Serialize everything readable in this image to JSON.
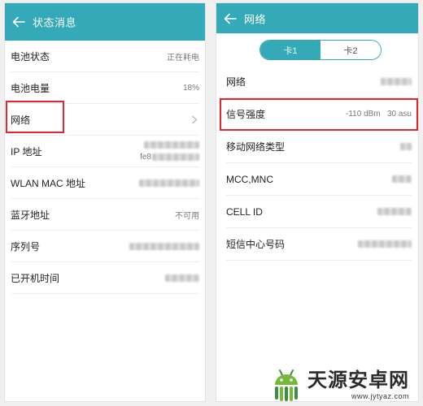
{
  "colors": {
    "accent": "#34a9b7",
    "highlight": "#e2262b",
    "logo_green": "#76b83c",
    "logo_dark": "#3f8d45"
  },
  "icons": {
    "back": "back-arrow-icon",
    "chevron": "chevron-right-icon",
    "logo": "android-logo-icon"
  },
  "left": {
    "title": "状态消息",
    "rows": [
      {
        "label": "电池状态",
        "value": "正在耗电"
      },
      {
        "label": "电池电量",
        "value": "18%"
      },
      {
        "label": "网络"
      },
      {
        "label": "IP 地址",
        "value_visible": "fe8"
      },
      {
        "label": "WLAN MAC 地址"
      },
      {
        "label": "蓝牙地址",
        "value": "不可用"
      },
      {
        "label": "序列号"
      },
      {
        "label": "已开机时间"
      }
    ]
  },
  "right": {
    "title": "网络",
    "tabs": [
      {
        "label": "卡1",
        "selected": true
      },
      {
        "label": "卡2",
        "selected": false
      }
    ],
    "rows": [
      {
        "label": "网络"
      },
      {
        "label": "信号强度",
        "value": "-110 dBm   30 asu"
      },
      {
        "label": "移动网络类型"
      },
      {
        "label": "MCC,MNC"
      },
      {
        "label": "CELL ID"
      },
      {
        "label": "短信中心号码"
      }
    ]
  },
  "watermark": {
    "name": "天源安卓网",
    "url": "www.jytyaz.com"
  }
}
